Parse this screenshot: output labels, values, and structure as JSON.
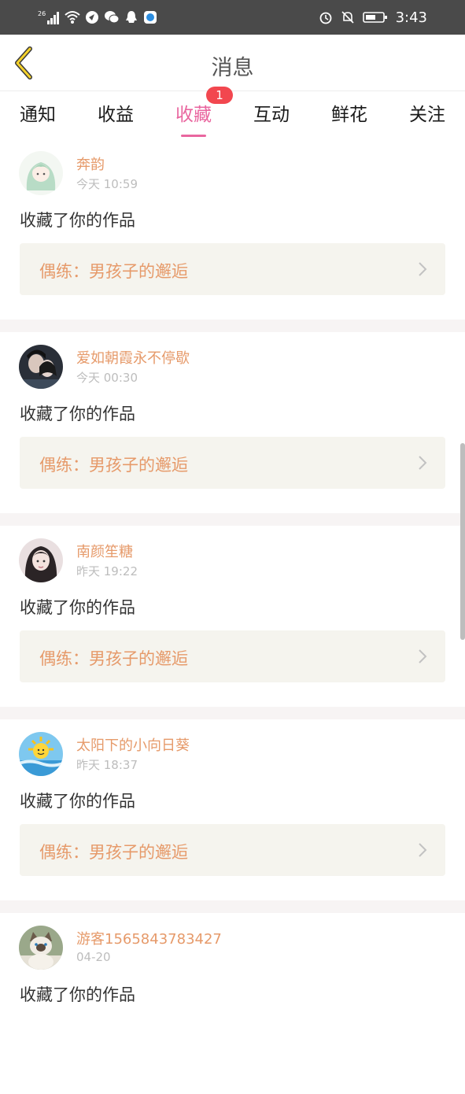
{
  "status_bar": {
    "signal_label": "26",
    "time": "3:43",
    "icons_left": [
      "signal-icon",
      "wifi-icon",
      "app-icon",
      "wechat-icon",
      "qq-icon",
      "browser-icon"
    ],
    "icons_right": [
      "alarm-icon",
      "mute-icon",
      "battery-icon"
    ]
  },
  "header": {
    "title": "消息"
  },
  "tabs": [
    {
      "label": "通知",
      "active": false
    },
    {
      "label": "收益",
      "active": false
    },
    {
      "label": "收藏",
      "active": true,
      "badge": "1"
    },
    {
      "label": "互动",
      "active": false
    },
    {
      "label": "鲜花",
      "active": false
    },
    {
      "label": "关注",
      "active": false
    }
  ],
  "colors": {
    "accent": "#e9669f",
    "username": "#e69a6a",
    "work_title": "#e69a6a",
    "badge": "#f2474f"
  },
  "feed": [
    {
      "username": "奔韵",
      "time": "今天 10:59",
      "action": "收藏了你的作品",
      "work": "偶练：男孩子的邂逅",
      "avatar_icon": "anime-girl-avatar"
    },
    {
      "username": "爱如朝霞永不停歇",
      "time": "今天 00:30",
      "action": "收藏了你的作品",
      "work": "偶练：男孩子的邂逅",
      "avatar_icon": "couple-photo-avatar"
    },
    {
      "username": "南颜笙糖",
      "time": "昨天 19:22",
      "action": "收藏了你的作品",
      "work": "偶练：男孩子的邂逅",
      "avatar_icon": "girl-photo-avatar"
    },
    {
      "username": "太阳下的小向日葵",
      "time": "昨天 18:37",
      "action": "收藏了你的作品",
      "work": "偶练：男孩子的邂逅",
      "avatar_icon": "sun-avatar"
    },
    {
      "username": "游客1565843783427",
      "time": "04-20",
      "action": "收藏了你的作品",
      "work": "",
      "avatar_icon": "cat-photo-avatar"
    }
  ]
}
